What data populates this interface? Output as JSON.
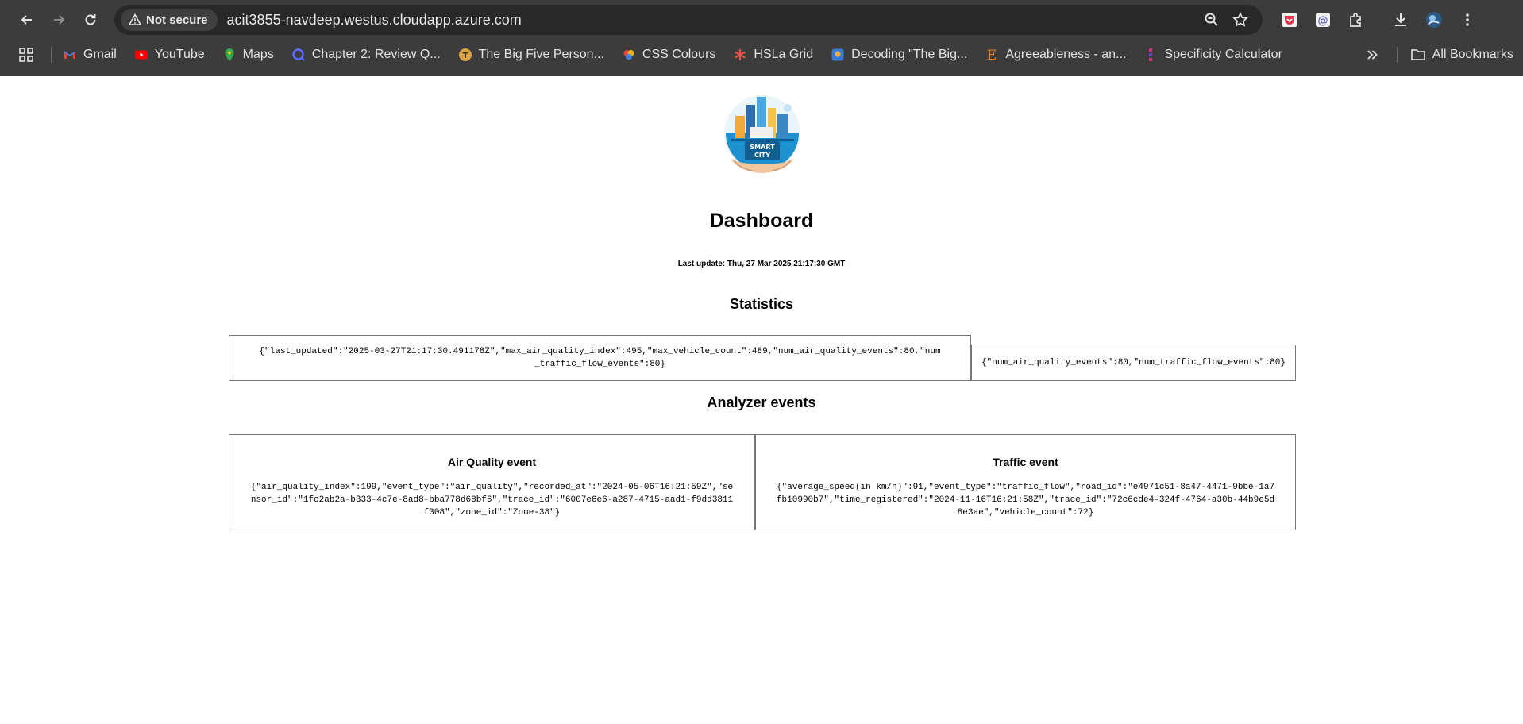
{
  "browser": {
    "security_label": "Not secure",
    "url": "acit3855-navdeep.westus.cloudapp.azure.com",
    "bookmarks": [
      {
        "label": "Gmail"
      },
      {
        "label": "YouTube"
      },
      {
        "label": "Maps"
      },
      {
        "label": "Chapter 2: Review Q..."
      },
      {
        "label": "The Big Five Person..."
      },
      {
        "label": "CSS Colours"
      },
      {
        "label": "HSLa Grid"
      },
      {
        "label": "Decoding \"The Big..."
      },
      {
        "label": "Agreeableness - an..."
      },
      {
        "label": "Specificity Calculator"
      }
    ],
    "all_bookmarks_label": "All Bookmarks"
  },
  "logo": {
    "text_line1": "SMART",
    "text_line2": "CITY"
  },
  "page": {
    "title": "Dashboard",
    "last_update": "Last update: Thu, 27 Mar 2025 21:17:30 GMT"
  },
  "statistics": {
    "heading": "Statistics",
    "box1": "{\"last_updated\":\"2025-03-27T21:17:30.491178Z\",\"max_air_quality_index\":495,\"max_vehicle_count\":489,\"num_air_quality_events\":80,\"num_traffic_flow_events\":80}",
    "box2": "{\"num_air_quality_events\":80,\"num_traffic_flow_events\":80}"
  },
  "analyzer": {
    "heading": "Analyzer events",
    "air_quality": {
      "title": "Air Quality event",
      "json": "{\"air_quality_index\":199,\"event_type\":\"air_quality\",\"recorded_at\":\"2024-05-06T16:21:59Z\",\"sensor_id\":\"1fc2ab2a-b333-4c7e-8ad8-bba778d68bf6\",\"trace_id\":\"6007e6e6-a287-4715-aad1-f9dd3811f308\",\"zone_id\":\"Zone-38\"}"
    },
    "traffic": {
      "title": "Traffic event",
      "json": "{\"average_speed(in km/h)\":91,\"event_type\":\"traffic_flow\",\"road_id\":\"e4971c51-8a47-4471-9bbe-1a7fb10990b7\",\"time_registered\":\"2024-11-16T16:21:58Z\",\"trace_id\":\"72c6cde4-324f-4764-a30b-44b9e5d8e3ae\",\"vehicle_count\":72}"
    }
  }
}
